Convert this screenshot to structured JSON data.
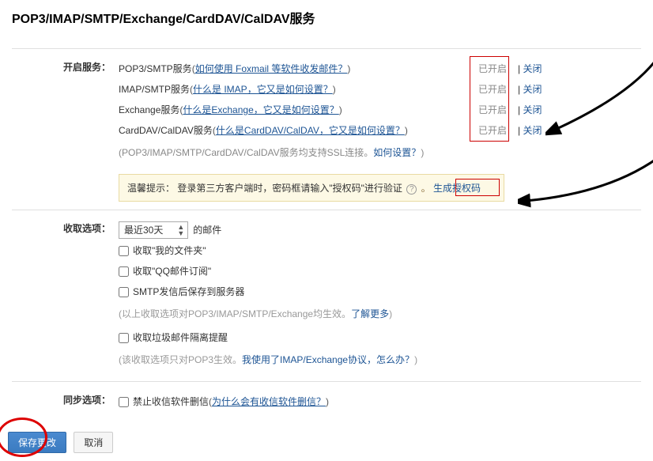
{
  "title": "POP3/IMAP/SMTP/Exchange/CardDAV/CalDAV服务",
  "labels": {
    "enable": "开启服务：",
    "receive": "收取选项：",
    "sync": "同步选项："
  },
  "services": [
    {
      "name": "POP3/SMTP服务",
      "help_pre": " (",
      "help_text": "如何使用 Foxmail 等软件收发邮件？",
      "help_post": ")",
      "on": "已开启",
      "off": "关闭"
    },
    {
      "name": "IMAP/SMTP服务",
      "help_pre": " (",
      "help_text": "什么是 IMAP，它又是如何设置？",
      "help_post": ")",
      "on": "已开启",
      "off": "关闭"
    },
    {
      "name": "Exchange服务",
      "help_pre": " (",
      "help_text": "什么是Exchange，它又是如何设置？",
      "help_post": ")",
      "on": "已开启",
      "off": "关闭"
    },
    {
      "name": "CardDAV/CalDAV服务",
      "help_pre": " (",
      "help_text": "什么是CardDAV/CalDAV，它又是如何设置？",
      "help_post": ")",
      "on": "已开启",
      "off": "关闭"
    }
  ],
  "ssl_note": {
    "pre": "(POP3/IMAP/SMTP/CardDAV/CalDAV服务均支持SSL连接。",
    "link": "如何设置？",
    "post": ")"
  },
  "tip": {
    "label": "温馨提示：",
    "text": "登录第三方客户端时，密码框请输入\"授权码\"进行验证",
    "gen": "生成授权码"
  },
  "recv": {
    "select": "最近30天",
    "select_suffix": "的邮件",
    "opt1": "收取\"我的文件夹\"",
    "opt2": "收取\"QQ邮件订阅\"",
    "opt3": "SMTP发信后保存到服务器",
    "note1_pre": "(以上收取选项对POP3/IMAP/SMTP/Exchange均生效。",
    "note1_link": "了解更多",
    "note1_post": ")",
    "opt4": "收取垃圾邮件隔离提醒",
    "note2_pre": "(该收取选项只对POP3生效。",
    "note2_link": "我使用了IMAP/Exchange协议，怎么办？",
    "note2_post": ")"
  },
  "sync": {
    "opt1": "禁止收信软件删信",
    "help_pre": " (",
    "help_text": "为什么会有收信软件删信？",
    "help_post": ")"
  },
  "footer": {
    "save": "保存更改",
    "cancel": "取消"
  }
}
